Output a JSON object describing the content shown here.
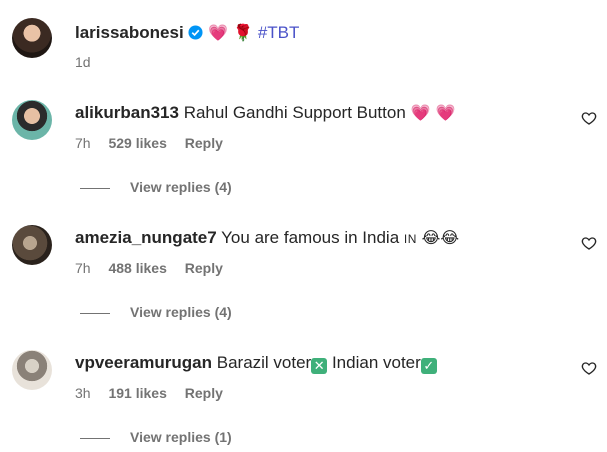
{
  "post": {
    "username": "larissabonesi",
    "caption_emojis": "💗 🌹",
    "hashtag": "#TBT",
    "age": "1d"
  },
  "comments": [
    {
      "username": "alikurban313",
      "text": "Rahul Gandhi Support Button",
      "emojis": "💗 💗",
      "time": "7h",
      "likes": "529 likes",
      "reply_label": "Reply",
      "view_replies": "View replies (4)"
    },
    {
      "username": "amezia_nungate7",
      "text": "You are famous in India",
      "flag_text": "IN",
      "emojis": "😂😂",
      "time": "7h",
      "likes": "488 likes",
      "reply_label": "Reply",
      "view_replies": "View replies (4)"
    },
    {
      "username": "vpveeramurugan",
      "text_a": "Barazil voter",
      "mark_a": "✕",
      "text_b": "Indian voter",
      "mark_b": "✓",
      "time": "3h",
      "likes": "191 likes",
      "reply_label": "Reply",
      "view_replies": "View replies (1)"
    }
  ],
  "colors": {
    "text": "#262626",
    "muted": "#737373",
    "hashtag": "#4a52c8",
    "heart": "#e8315b",
    "check": "#3fb07a"
  }
}
